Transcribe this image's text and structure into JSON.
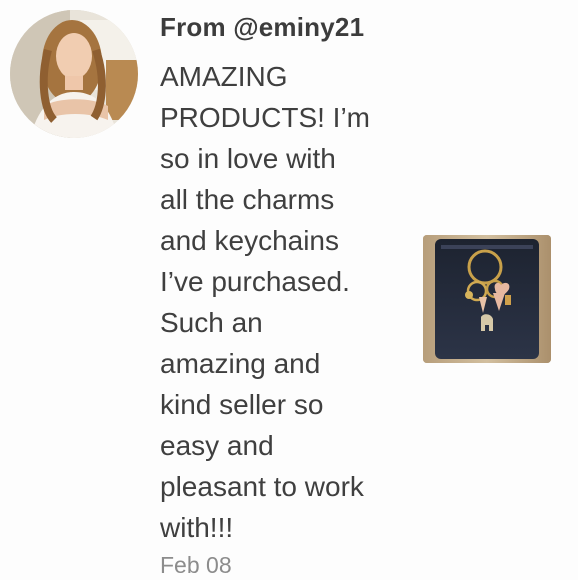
{
  "review": {
    "author_label": "From @eminy21",
    "body_lines": [
      "AMAZING",
      "PRODUCTS! I’m",
      "so in love with",
      "all the charms",
      "and keychains",
      "I’ve purchased.",
      "Such an",
      "amazing and",
      "kind seller so",
      "easy and",
      "pleasant to work",
      "with!!!"
    ],
    "date": "Feb 08"
  },
  "colors": {
    "text": "#3f3f3f",
    "date": "#8c8c8c",
    "background": "#fdfdfd"
  },
  "images": {
    "avatar": "reviewer-avatar-photo",
    "product": "keychain-charms-photo"
  }
}
